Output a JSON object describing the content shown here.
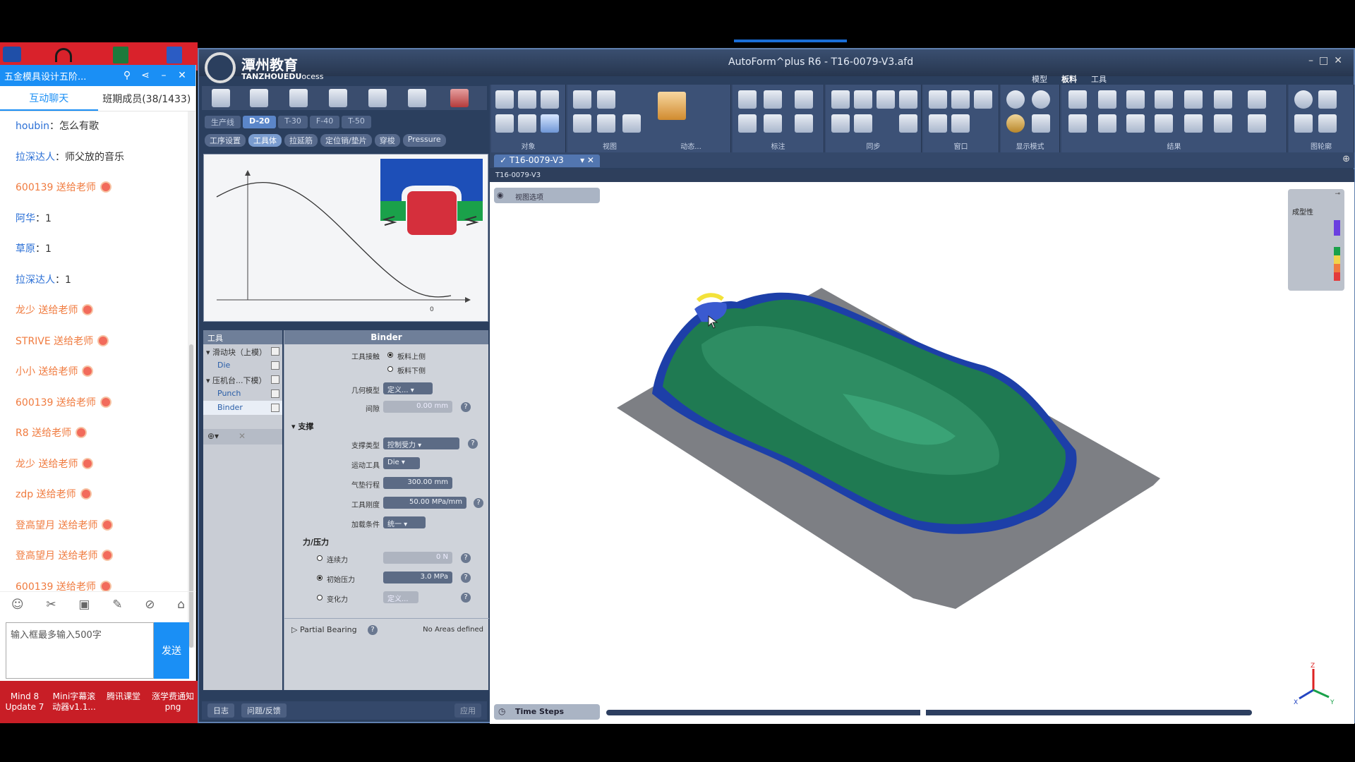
{
  "chat": {
    "title": "五金模具设计五阶...",
    "tabs": [
      "互动聊天",
      "班期成员(38/1433)"
    ],
    "messages": [
      {
        "name": "houbin",
        "text": "：怎么有歌",
        "gift": false
      },
      {
        "name": "拉深达人",
        "text": "：师父放的音乐",
        "gift": false
      },
      {
        "name": "600139",
        "text": " 送给老师",
        "gift": true
      },
      {
        "name": "阿华",
        "text": "：1",
        "gift": false
      },
      {
        "name": "草原",
        "text": "：1",
        "gift": false
      },
      {
        "name": "拉深达人",
        "text": "：1",
        "gift": false
      },
      {
        "name": "龙少",
        "text": " 送给老师",
        "gift": true
      },
      {
        "name": "STRIVE",
        "text": " 送给老师",
        "gift": true
      },
      {
        "name": "小小",
        "text": " 送给老师",
        "gift": true
      },
      {
        "name": "600139",
        "text": " 送给老师",
        "gift": true
      },
      {
        "name": "R8",
        "text": " 送给老师",
        "gift": true
      },
      {
        "name": "龙少",
        "text": " 送给老师",
        "gift": true
      },
      {
        "name": "zdp",
        "text": " 送给老师",
        "gift": true
      },
      {
        "name": "登高望月",
        "text": " 送给老师",
        "gift": true
      },
      {
        "name": "登高望月",
        "text": " 送给老师",
        "gift": true
      },
      {
        "name": "600139",
        "text": " 送给老师",
        "gift": true
      }
    ],
    "input_placeholder": "输入框最多输入500字",
    "send_label": "发送"
  },
  "taskbar": {
    "items": [
      "Mind 8\nUpdate 7",
      "Mini字幕滚\n动器v1.1...",
      "腾讯课堂",
      "涨学费通知\npng"
    ]
  },
  "app": {
    "title": "AutoForm^plus R6 - T16-0079-V3.afd",
    "logo_cn": "潭州教育",
    "logo_en": "TANZHOUEDU",
    "logo_tail": "ocess",
    "menu_tabs": [
      "模型",
      "板料",
      "工具"
    ],
    "ribbon_groups": [
      "对象",
      "视图",
      "动态...",
      "标注",
      "同步",
      "窗口",
      "显示模式",
      "结果",
      "图轮廓"
    ],
    "step_tabs": [
      "生产线",
      "D-20",
      "T-30",
      "F-40",
      "T-50"
    ],
    "sub_tabs": [
      "工序设置",
      "工具体",
      "拉延筋",
      "定位销/垫片",
      "穿梭",
      "Pressure"
    ],
    "graph_zero": "0",
    "tools_header": "工具",
    "tools": [
      {
        "label": "滑动块（上模）",
        "child": false
      },
      {
        "label": "Die",
        "child": true
      },
      {
        "label": "压机台...下模）",
        "child": false
      },
      {
        "label": "Punch",
        "child": true
      },
      {
        "label": "Binder",
        "child": true
      }
    ],
    "props_header": "Binder",
    "props": {
      "tool_contact_label": "工具接触",
      "contact_above": "板料上侧",
      "contact_below": "板料下侧",
      "geometry_label": "几何模型",
      "geometry_val": "定义...",
      "gap_label": "间隙",
      "gap_val": "0.00 mm",
      "support_section": "支撑",
      "support_type_label": "支撑类型",
      "support_type_val": "控制受力",
      "motion_tool_label": "运动工具",
      "motion_tool_val": "Die",
      "cushion_stroke_label": "气垫行程",
      "cushion_stroke_val": "300.00 mm",
      "tool_stiffness_label": "工具刚度",
      "tool_stiffness_val": "50.00 MPa/mm",
      "load_cond_label": "加载条件",
      "load_cond_val": "统一",
      "force_section": "力/压力",
      "const_force_label": "连续力",
      "const_force_val": "0 N",
      "init_pressure_label": "初始压力",
      "init_pressure_val": "3.0 MPa",
      "var_force_label": "变化力",
      "var_force_val": "定义...",
      "partial_bearing": "Partial Bearing",
      "no_areas": "No Areas defined"
    },
    "bottom_buttons": [
      "日志",
      "问题/反馈",
      "应用"
    ],
    "doc_tab": "T16-0079-V3",
    "doc_subtitle": "T16-0079-V3",
    "view_options": "视图选项",
    "legend_title": "成型性",
    "time_steps": "Time Steps",
    "axes": {
      "z": "Z",
      "x": "X",
      "y": "Y"
    }
  },
  "colors": {
    "part_green": "#1f7a52",
    "stretch_blue": "#1d3fa8",
    "blank_gray": "#7d7f84",
    "accent": "#1a8ff5"
  }
}
